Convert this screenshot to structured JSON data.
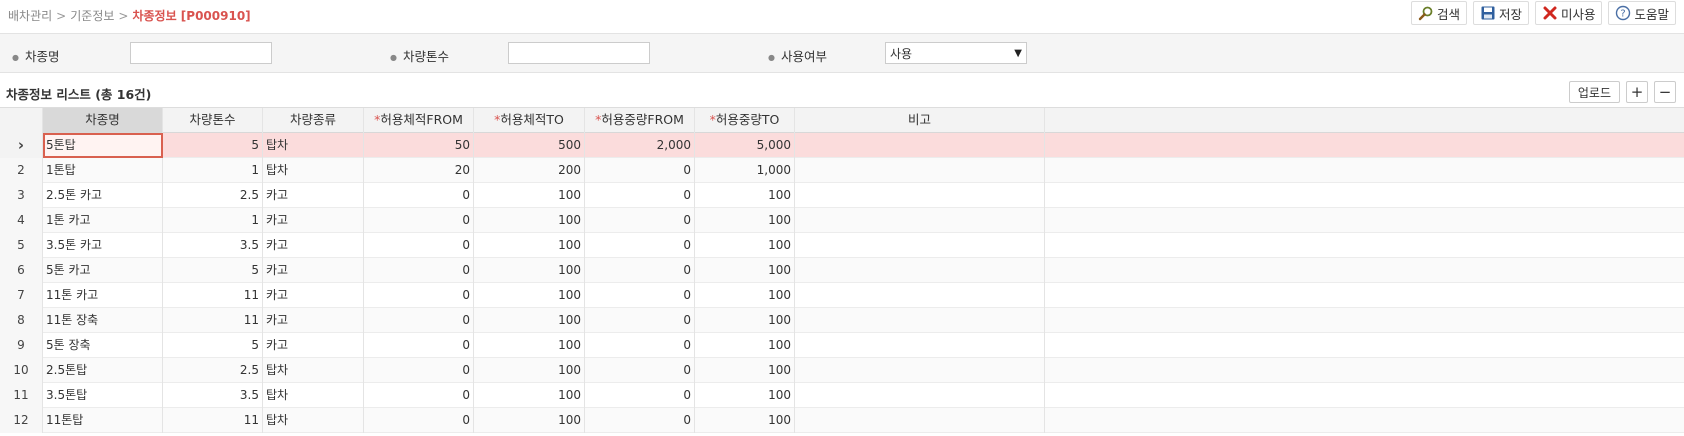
{
  "breadcrumb": {
    "items": [
      "배차관리",
      "기준정보"
    ],
    "separator": ">",
    "current": "차종정보 [P000910]"
  },
  "toolbar": {
    "search_label": "검색",
    "save_label": "저장",
    "unused_label": "미사용",
    "help_label": "도움말"
  },
  "search": {
    "name_label": "차종명",
    "name_value": "",
    "ton_label": "차량톤수",
    "ton_value": "",
    "use_label": "사용여부",
    "use_value": "사용"
  },
  "list": {
    "title": "차종정보 리스트 (총 16건)",
    "upload_label": "업로드",
    "add_label": "+",
    "remove_label": "−"
  },
  "grid": {
    "columns": [
      "차종명",
      "차량톤수",
      "차량종류",
      "허용체적FROM",
      "허용체적TO",
      "허용중량FROM",
      "허용중량TO",
      "비고"
    ],
    "required_mark": "*",
    "selected_row_marker": "›",
    "rows": [
      {
        "idx": "",
        "name": "5톤탑",
        "ton": "5",
        "type": "탑차",
        "vfrom": "50",
        "vto": "500",
        "wfrom": "2,000",
        "wto": "5,000",
        "note": ""
      },
      {
        "idx": "2",
        "name": "1톤탑",
        "ton": "1",
        "type": "탑차",
        "vfrom": "20",
        "vto": "200",
        "wfrom": "0",
        "wto": "1,000",
        "note": ""
      },
      {
        "idx": "3",
        "name": "2.5톤 카고",
        "ton": "2.5",
        "type": "카고",
        "vfrom": "0",
        "vto": "100",
        "wfrom": "0",
        "wto": "100",
        "note": ""
      },
      {
        "idx": "4",
        "name": "1톤 카고",
        "ton": "1",
        "type": "카고",
        "vfrom": "0",
        "vto": "100",
        "wfrom": "0",
        "wto": "100",
        "note": ""
      },
      {
        "idx": "5",
        "name": "3.5톤 카고",
        "ton": "3.5",
        "type": "카고",
        "vfrom": "0",
        "vto": "100",
        "wfrom": "0",
        "wto": "100",
        "note": ""
      },
      {
        "idx": "6",
        "name": "5톤 카고",
        "ton": "5",
        "type": "카고",
        "vfrom": "0",
        "vto": "100",
        "wfrom": "0",
        "wto": "100",
        "note": ""
      },
      {
        "idx": "7",
        "name": "11톤 카고",
        "ton": "11",
        "type": "카고",
        "vfrom": "0",
        "vto": "100",
        "wfrom": "0",
        "wto": "100",
        "note": ""
      },
      {
        "idx": "8",
        "name": "11톤 장축",
        "ton": "11",
        "type": "카고",
        "vfrom": "0",
        "vto": "100",
        "wfrom": "0",
        "wto": "100",
        "note": ""
      },
      {
        "idx": "9",
        "name": "5톤 장축",
        "ton": "5",
        "type": "카고",
        "vfrom": "0",
        "vto": "100",
        "wfrom": "0",
        "wto": "100",
        "note": ""
      },
      {
        "idx": "10",
        "name": "2.5톤탑",
        "ton": "2.5",
        "type": "탑차",
        "vfrom": "0",
        "vto": "100",
        "wfrom": "0",
        "wto": "100",
        "note": ""
      },
      {
        "idx": "11",
        "name": "3.5톤탑",
        "ton": "3.5",
        "type": "탑차",
        "vfrom": "0",
        "vto": "100",
        "wfrom": "0",
        "wto": "100",
        "note": ""
      },
      {
        "idx": "12",
        "name": "11톤탑",
        "ton": "11",
        "type": "탑차",
        "vfrom": "0",
        "vto": "100",
        "wfrom": "0",
        "wto": "100",
        "note": ""
      }
    ]
  },
  "colors": {
    "accent": "#d9534f",
    "selected_row": "#fbdcdc"
  }
}
